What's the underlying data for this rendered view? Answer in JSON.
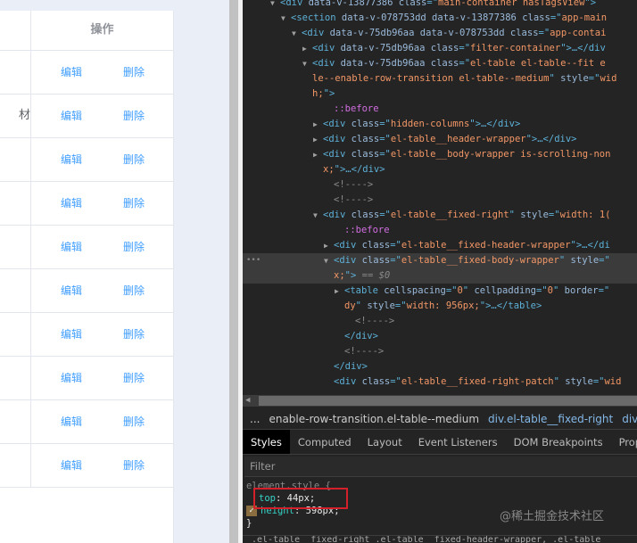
{
  "table": {
    "header_label": "操作",
    "rows": [
      {
        "partial_text": "",
        "edit": "编辑",
        "delete": "删除"
      },
      {
        "partial_text": "材",
        "edit": "编辑",
        "delete": "删除"
      },
      {
        "partial_text": "",
        "edit": "编辑",
        "delete": "删除"
      },
      {
        "partial_text": "",
        "edit": "编辑",
        "delete": "删除"
      },
      {
        "partial_text": "",
        "edit": "编辑",
        "delete": "删除"
      },
      {
        "partial_text": "",
        "edit": "编辑",
        "delete": "删除"
      },
      {
        "partial_text": "",
        "edit": "编辑",
        "delete": "删除"
      },
      {
        "partial_text": "",
        "edit": "编辑",
        "delete": "删除"
      },
      {
        "partial_text": "",
        "edit": "编辑",
        "delete": "删除"
      },
      {
        "partial_text": "",
        "edit": "编辑",
        "delete": "删除"
      }
    ]
  },
  "devtools": {
    "dom_lines": [
      {
        "depth": 0,
        "tri": "▼",
        "segs": [
          [
            "t",
            "<div "
          ],
          [
            "a",
            "data-v-13877386 "
          ],
          [
            "a",
            "class"
          ],
          [
            "t",
            "=\""
          ],
          [
            "v",
            "main-container hasTagsView"
          ],
          [
            "t",
            "\">"
          ]
        ]
      },
      {
        "depth": 1,
        "tri": "▼",
        "segs": [
          [
            "t",
            "<section "
          ],
          [
            "a",
            "data-v-078753dd data-v-13877386 "
          ],
          [
            "a",
            "class"
          ],
          [
            "t",
            "=\""
          ],
          [
            "v",
            "app-main"
          ]
        ]
      },
      {
        "depth": 2,
        "tri": "▼",
        "segs": [
          [
            "t",
            "<div "
          ],
          [
            "a",
            "data-v-75db96aa data-v-078753dd "
          ],
          [
            "a",
            "class"
          ],
          [
            "t",
            "=\""
          ],
          [
            "v",
            "app-contai"
          ]
        ]
      },
      {
        "depth": 3,
        "tri": "▶",
        "segs": [
          [
            "t",
            "<div "
          ],
          [
            "a",
            "data-v-75db96aa "
          ],
          [
            "a",
            "class"
          ],
          [
            "t",
            "=\""
          ],
          [
            "v",
            "filter-container"
          ],
          [
            "t",
            "\">…</div"
          ]
        ]
      },
      {
        "depth": 3,
        "tri": "▼",
        "segs": [
          [
            "t",
            "<div "
          ],
          [
            "a",
            "data-v-75db96aa "
          ],
          [
            "a",
            "class"
          ],
          [
            "t",
            "=\""
          ],
          [
            "v",
            "el-table el-table--fit e"
          ]
        ]
      },
      {
        "depth": 3,
        "tri": "",
        "segs": [
          [
            "v",
            "le--enable-row-transition el-table--medium"
          ],
          [
            "t",
            "\" "
          ],
          [
            "a",
            "style"
          ],
          [
            "t",
            "=\""
          ],
          [
            "v",
            "wid"
          ]
        ]
      },
      {
        "depth": 3,
        "tri": "",
        "segs": [
          [
            "v",
            "h;"
          ],
          [
            "t",
            "\">"
          ]
        ]
      },
      {
        "depth": 5,
        "tri": "",
        "segs": [
          [
            "ps",
            "::before"
          ]
        ]
      },
      {
        "depth": 4,
        "tri": "▶",
        "segs": [
          [
            "t",
            "<div "
          ],
          [
            "a",
            "class"
          ],
          [
            "t",
            "=\""
          ],
          [
            "v",
            "hidden-columns"
          ],
          [
            "t",
            "\">…</div>"
          ]
        ]
      },
      {
        "depth": 4,
        "tri": "▶",
        "segs": [
          [
            "t",
            "<div "
          ],
          [
            "a",
            "class"
          ],
          [
            "t",
            "=\""
          ],
          [
            "v",
            "el-table__header-wrapper"
          ],
          [
            "t",
            "\">…</div>"
          ]
        ]
      },
      {
        "depth": 4,
        "tri": "▶",
        "segs": [
          [
            "t",
            "<div "
          ],
          [
            "a",
            "class"
          ],
          [
            "t",
            "=\""
          ],
          [
            "v",
            "el-table__body-wrapper is-scrolling-non"
          ]
        ]
      },
      {
        "depth": 4,
        "tri": "",
        "segs": [
          [
            "v",
            "x;"
          ],
          [
            "t",
            "\">…</div>"
          ]
        ]
      },
      {
        "depth": 5,
        "tri": "",
        "segs": [
          [
            "cm",
            "<!---->"
          ]
        ]
      },
      {
        "depth": 5,
        "tri": "",
        "segs": [
          [
            "cm",
            "<!---->"
          ]
        ]
      },
      {
        "depth": 4,
        "tri": "▼",
        "segs": [
          [
            "t",
            "<div "
          ],
          [
            "a",
            "class"
          ],
          [
            "t",
            "=\""
          ],
          [
            "v",
            "el-table__fixed-right"
          ],
          [
            "t",
            "\" "
          ],
          [
            "a",
            "style"
          ],
          [
            "t",
            "=\""
          ],
          [
            "v",
            "width: 1("
          ]
        ]
      },
      {
        "depth": 6,
        "tri": "",
        "segs": [
          [
            "ps",
            "::before"
          ]
        ]
      },
      {
        "depth": 5,
        "tri": "▶",
        "segs": [
          [
            "t",
            "<div "
          ],
          [
            "a",
            "class"
          ],
          [
            "t",
            "=\""
          ],
          [
            "v",
            "el-table__fixed-header-wrapper"
          ],
          [
            "t",
            "\">…</di"
          ]
        ]
      },
      {
        "depth": 5,
        "tri": "▼",
        "selected": true,
        "segs": [
          [
            "t",
            "<div "
          ],
          [
            "a",
            "class"
          ],
          [
            "t",
            "=\""
          ],
          [
            "v",
            "el-table__fixed-body-wrapper"
          ],
          [
            "t",
            "\" "
          ],
          [
            "a",
            "style"
          ],
          [
            "t",
            "=\""
          ]
        ]
      },
      {
        "depth": 5,
        "tri": "",
        "selected": true,
        "segs": [
          [
            "v",
            "x;"
          ],
          [
            "t",
            "\">"
          ],
          [
            "dl",
            " == $0"
          ]
        ]
      },
      {
        "depth": 6,
        "tri": "▶",
        "segs": [
          [
            "t",
            "<table "
          ],
          [
            "a",
            "cellspacing"
          ],
          [
            "t",
            "=\""
          ],
          [
            "v",
            "0"
          ],
          [
            "t",
            "\" "
          ],
          [
            "a",
            "cellpadding"
          ],
          [
            "t",
            "=\""
          ],
          [
            "v",
            "0"
          ],
          [
            "t",
            "\" "
          ],
          [
            "a",
            "border"
          ],
          [
            "t",
            "=\""
          ]
        ]
      },
      {
        "depth": 6,
        "tri": "",
        "segs": [
          [
            "v",
            "dy"
          ],
          [
            "t",
            "\" "
          ],
          [
            "a",
            "style"
          ],
          [
            "t",
            "=\""
          ],
          [
            "v",
            "width: 956px;"
          ],
          [
            "t",
            "\">…</table>"
          ]
        ]
      },
      {
        "depth": 7,
        "tri": "",
        "segs": [
          [
            "cm",
            "<!---->"
          ]
        ]
      },
      {
        "depth": 6,
        "tri": "",
        "segs": [
          [
            "t",
            "</div>"
          ]
        ]
      },
      {
        "depth": 6,
        "tri": "",
        "segs": [
          [
            "cm",
            "<!---->"
          ]
        ]
      },
      {
        "depth": 5,
        "tri": "",
        "segs": [
          [
            "t",
            "</div>"
          ]
        ]
      },
      {
        "depth": 5,
        "tri": "",
        "segs": [
          [
            "t",
            "<div "
          ],
          [
            "a",
            "class"
          ],
          [
            "t",
            "=\""
          ],
          [
            "v",
            "el-table__fixed-right-patch"
          ],
          [
            "t",
            "\" "
          ],
          [
            "a",
            "style"
          ],
          [
            "t",
            "=\""
          ],
          [
            "v",
            "wid"
          ]
        ]
      }
    ],
    "breadcrumbs": [
      "...",
      "enable-row-transition.el-table--medium",
      "div.el-table__fixed-right",
      "div.el-tab"
    ],
    "tabs": [
      "Styles",
      "Computed",
      "Layout",
      "Event Listeners",
      "DOM Breakpoints",
      "Propert"
    ],
    "active_tab": "Styles",
    "filter_placeholder": "Filter",
    "styles": {
      "selector": "element.style {",
      "prop1_name": "top",
      "prop1_value": "44px;",
      "prop2_name": "height",
      "prop2_value": "598px;",
      "close": "}",
      "next_rule": ".el-table__fixed-right .el-table__fixed-header-wrapper, .el-table"
    },
    "watermark": "@稀土掘金技术社区"
  }
}
